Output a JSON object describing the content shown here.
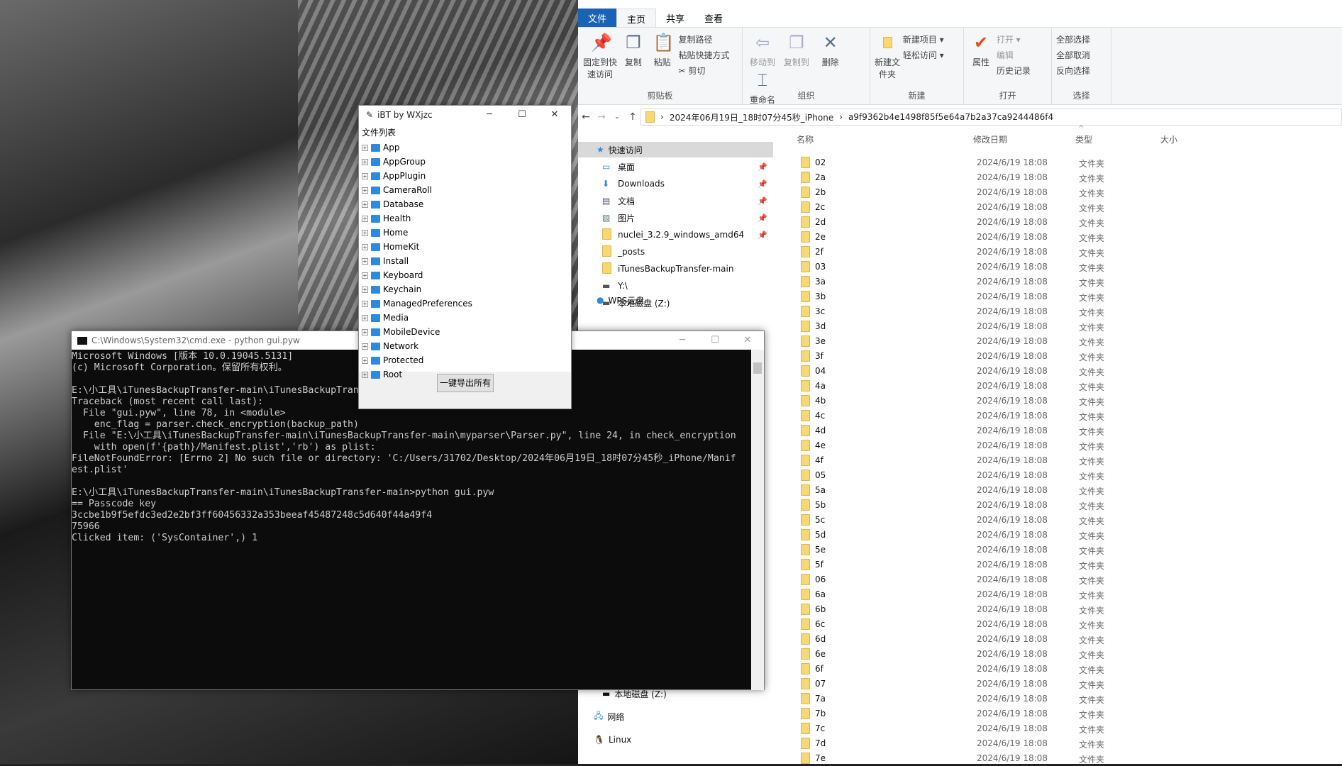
{
  "explorer": {
    "tabs": [
      "文件",
      "主页",
      "共享",
      "查看"
    ],
    "ribbon": {
      "clipboard": {
        "label": "剪贴板",
        "pin": "固定到快速访问",
        "copy": "复制",
        "paste": "粘贴",
        "copy_path": "复制路径",
        "paste_shortcut": "粘贴快捷方式",
        "cut": "剪切"
      },
      "organize": {
        "label": "组织",
        "move_to": "移动到",
        "copy_to": "复制到",
        "delete": "删除",
        "rename": "重命名"
      },
      "new": {
        "label": "新建",
        "new_folder": "新建文件夹",
        "new_item": "新建项目 ▾",
        "easy_access": "轻松访问 ▾"
      },
      "open": {
        "label": "打开",
        "properties": "属性",
        "open": "打开 ▾",
        "edit": "编辑",
        "history": "历史记录"
      },
      "select": {
        "label": "选择",
        "select_all": "全部选择",
        "select_none": "全部取消",
        "invert": "反向选择"
      }
    },
    "address": {
      "segments": [
        "2024年06月19日_18时07分45秒_iPhone",
        "a9f9362b4e1498f85f5e64a7b2a37ca9244486f4"
      ]
    },
    "nav": {
      "quick_access": "快速访问",
      "items": [
        "桌面",
        "Downloads",
        "文档",
        "图片",
        "nuclei_3.2.9_windows_amd64",
        "_posts",
        "iTunesBackupTransfer-main",
        "Y:\\",
        "本地磁盘 (Z:)"
      ],
      "wps": "WPS云盘",
      "local_z": "本地磁盘 (Z:)",
      "network": "网络",
      "linux": "Linux"
    },
    "columns": [
      "名称",
      "修改日期",
      "类型",
      "大小"
    ],
    "rows": [
      "02",
      "2a",
      "2b",
      "2c",
      "2d",
      "2e",
      "2f",
      "03",
      "3a",
      "3b",
      "3c",
      "3d",
      "3e",
      "3f",
      "04",
      "4a",
      "4b",
      "4c",
      "4d",
      "4e",
      "4f",
      "05",
      "5a",
      "5b",
      "5c",
      "5d",
      "5e",
      "5f",
      "06",
      "6a",
      "6b",
      "6c",
      "6d",
      "6e",
      "6f",
      "07",
      "7a",
      "7b",
      "7c",
      "7d",
      "7e"
    ],
    "row_date": "2024/6/19 18:08",
    "row_type": "文件夹"
  },
  "ibt": {
    "title": "iBT by WXjzc",
    "list_label": "文件列表",
    "items": [
      "App",
      "AppGroup",
      "AppPlugin",
      "CameraRoll",
      "Database",
      "Health",
      "Home",
      "HomeKit",
      "Install",
      "Keyboard",
      "Keychain",
      "ManagedPreferences",
      "Media",
      "MobileDevice",
      "Network",
      "Protected",
      "Root"
    ],
    "export_button": "一键导出所有"
  },
  "cmd": {
    "title": "C:\\Windows\\System32\\cmd.exe - python  gui.pyw",
    "output": "Microsoft Windows [版本 10.0.19045.5131]\n(c) Microsoft Corporation。保留所有权利。\n\nE:\\小工具\\iTunesBackupTransfer-main\\iTunesBackupTransfer-main>python gui.pyw\nTraceback (most recent call last):\n  File \"gui.pyw\", line 78, in <module>\n    enc_flag = parser.check_encryption(backup_path)\n  File \"E:\\小工具\\iTunesBackupTransfer-main\\iTunesBackupTransfer-main\\myparser\\Parser.py\", line 24, in check_encryption\n    with open(f'{path}/Manifest.plist','rb') as plist:\nFileNotFoundError: [Errno 2] No such file or directory: 'C:/Users/31702/Desktop/2024年06月19日_18时07分45秒_iPhone/Manif\nest.plist'\n\nE:\\小工具\\iTunesBackupTransfer-main\\iTunesBackupTransfer-main>python gui.pyw\n== Passcode key\n3ccbe1b9f5efdc3ed2e2bf3ff60456332a353beeaf45487248c5d640f44a49f4\n75966\nClicked item: ('SysContainer',) 1"
  },
  "colors": {
    "accent": "#1a63b4",
    "folder": "#f8d775",
    "console_bg": "#0c0c0c"
  }
}
